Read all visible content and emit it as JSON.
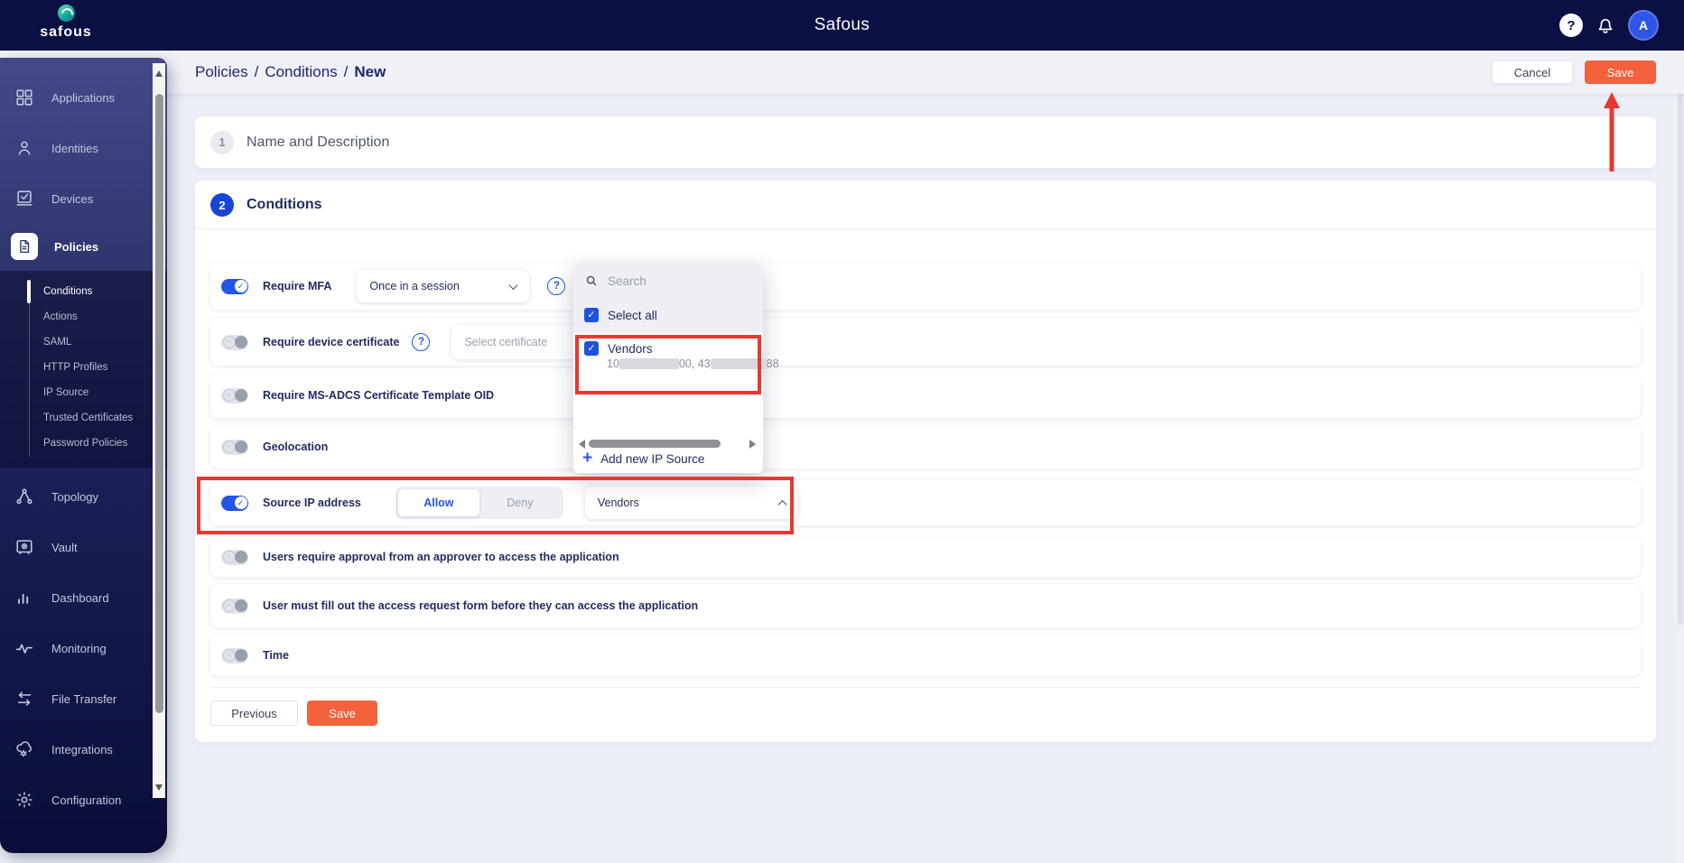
{
  "topbar": {
    "brand": "safous",
    "title": "Safous",
    "avatar_initial": "A"
  },
  "header": {
    "breadcrumb": {
      "section": "Policies",
      "subsection": "Conditions",
      "separator": "/",
      "current": "New"
    },
    "cancel_label": "Cancel",
    "save_label": "Save"
  },
  "sidebar": {
    "items": [
      {
        "label": "Applications",
        "icon": "grid-icon"
      },
      {
        "label": "Identities",
        "icon": "person-icon"
      },
      {
        "label": "Devices",
        "icon": "device-check-icon"
      },
      {
        "label": "Policies",
        "icon": "document-icon",
        "active": true
      },
      {
        "label": "Topology",
        "icon": "topology-icon"
      },
      {
        "label": "Vault",
        "icon": "vault-icon"
      },
      {
        "label": "Dashboard",
        "icon": "bar-chart-icon"
      },
      {
        "label": "Monitoring",
        "icon": "pulse-icon"
      },
      {
        "label": "File Transfer",
        "icon": "transfer-arrows-icon"
      },
      {
        "label": "Integrations",
        "icon": "cloud-gear-icon"
      },
      {
        "label": "Configuration",
        "icon": "gear-icon"
      }
    ],
    "policies_submenu": [
      {
        "label": "Conditions",
        "active": true
      },
      {
        "label": "Actions"
      },
      {
        "label": "SAML"
      },
      {
        "label": "HTTP Profiles"
      },
      {
        "label": "IP Source"
      },
      {
        "label": "Trusted Certificates"
      },
      {
        "label": "Password Policies"
      }
    ]
  },
  "steps": {
    "step1": {
      "number": "1",
      "title": "Name and Description"
    },
    "step2": {
      "number": "2",
      "title": "Conditions"
    }
  },
  "conditions": {
    "require_mfa": {
      "label": "Require MFA",
      "toggle": "on",
      "dropdown_value": "Once in a session"
    },
    "device_cert": {
      "label": "Require device certificate",
      "toggle": "off",
      "dropdown_placeholder": "Select certificate"
    },
    "ms_adcs": {
      "label": "Require MS-ADCS Certificate Template OID",
      "toggle": "off"
    },
    "geolocation": {
      "label": "Geolocation",
      "toggle": "off"
    },
    "source_ip": {
      "label": "Source IP address",
      "toggle": "on",
      "allow_label": "Allow",
      "deny_label": "Deny",
      "selected": "Allow",
      "dropdown_value": "Vendors"
    },
    "approval": {
      "label": "Users require approval from an approver to access the application",
      "toggle": "off"
    },
    "request_form": {
      "label": "User must fill out the access request form before they can access the application",
      "toggle": "off"
    },
    "time": {
      "label": "Time",
      "toggle": "off"
    },
    "previous_label": "Previous",
    "save_label": "Save"
  },
  "ip_dropdown": {
    "search_placeholder": "Search",
    "select_all_label": "Select all",
    "option": {
      "label": "Vendors",
      "checked": true,
      "value_part1": "10",
      "value_part2": "00, 43",
      "value_part3": "88"
    },
    "add_new_label": "Add new IP Source"
  },
  "glyphs": {
    "check": "✓",
    "cross": "×",
    "question": "?",
    "plus": "+"
  },
  "colors": {
    "navbar_navy": "#0a0f44",
    "accent_blue": "#2156e8",
    "step_blue": "#1746d6",
    "orange": "#f4613d",
    "annotation_red": "#e8382f",
    "content_bg": "#edeff6",
    "text_navy": "#232b60",
    "muted_gray": "#9aa0ad"
  }
}
